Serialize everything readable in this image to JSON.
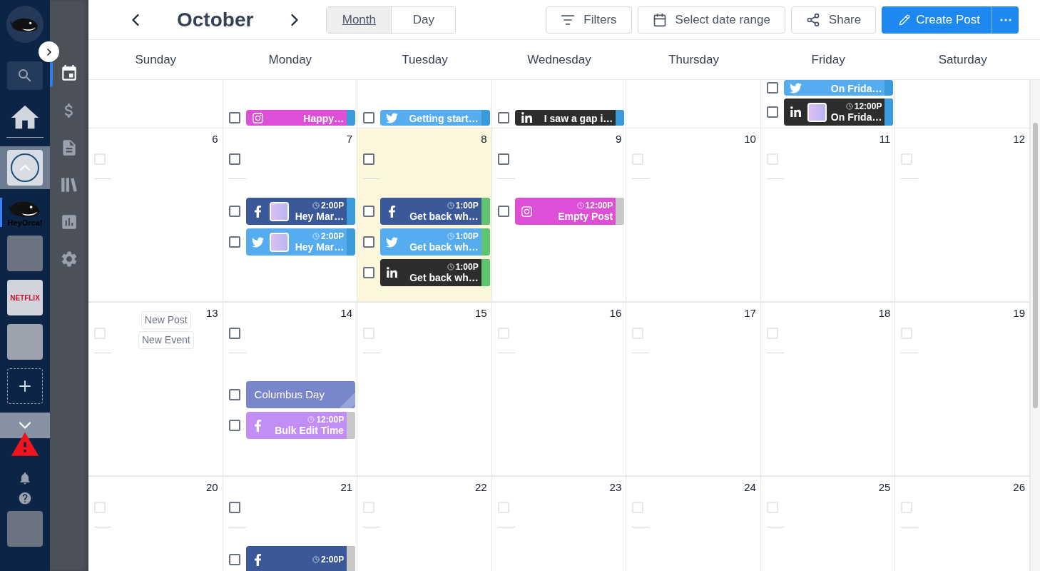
{
  "sidebar": {
    "logo": {
      "kind": "whale"
    },
    "workspaces": [
      {
        "kind": "emblem",
        "selected": false
      },
      {
        "kind": "whale",
        "label": "HeyOrca!",
        "selected": true
      },
      {
        "kind": "photo",
        "selected": false
      },
      {
        "kind": "wordmark",
        "label": "NETFLIX",
        "selected": false
      },
      {
        "kind": "texture",
        "selected": false
      },
      {
        "kind": "add",
        "selected": false
      }
    ]
  },
  "rail": [
    {
      "kind": "calendar",
      "selected": true
    },
    {
      "kind": "dollar",
      "selected": false
    },
    {
      "kind": "document",
      "selected": false
    },
    {
      "kind": "library",
      "selected": false
    },
    {
      "kind": "chart",
      "selected": false
    },
    {
      "kind": "settings",
      "selected": false
    }
  ],
  "header": {
    "month": "October",
    "view_tabs": [
      {
        "label": "Month",
        "selected": true
      },
      {
        "label": "Day",
        "selected": false
      }
    ],
    "buttons": [
      {
        "kind": "filter",
        "label": "Filters"
      },
      {
        "kind": "calendar",
        "label": "Select date range"
      },
      {
        "kind": "share",
        "label": "Share"
      },
      {
        "kind": "create",
        "label": "Create Post"
      },
      {
        "kind": "more"
      }
    ]
  },
  "weekdays": [
    "Sunday",
    "Monday",
    "Tuesday",
    "Wednesday",
    "Thursday",
    "Friday",
    "Saturday"
  ],
  "weeks": [
    {
      "cut_off": true,
      "days": [
        {
          "today": false
        },
        {
          "today": false,
          "posts": [
            {
              "kind": "instagram",
              "title": "Happy…",
              "color": "#dd4fd6",
              "status": {
                "color": "#3b9ad9"
              },
              "checked": false
            }
          ]
        },
        {
          "today": false,
          "posts": [
            {
              "kind": "twitter",
              "title": "Getting start…",
              "color": "#55acee",
              "status": {
                "color": "#3b9ad9"
              },
              "checked": false
            }
          ]
        },
        {
          "today": false,
          "posts": [
            {
              "kind": "linkedin",
              "title": "I saw a gap i…",
              "color": "#2d2d2d",
              "status": {
                "color": "#3b9ad9"
              },
              "checked": false
            }
          ]
        },
        {
          "today": false
        },
        {
          "today": false,
          "posts": [
            {
              "kind": "twitter",
              "title": "On Frida…",
              "color": "#55acee",
              "status": {
                "color": "#3b9ad9"
              },
              "checked": false
            },
            {
              "kind": "linkedin",
              "thumbnail": true,
              "time": "12:00P",
              "title": "On Frida…",
              "color": "#2d2d2d",
              "status": {
                "color": "#3b9ad9"
              },
              "checked": false
            }
          ]
        },
        {
          "today": false
        }
      ]
    },
    {
      "cut_off": false,
      "days": [
        {
          "number": "6",
          "today": false,
          "checked": false
        },
        {
          "number": "7",
          "today": false,
          "checked": false,
          "posts": [
            {
              "kind": "facebook",
              "thumbnail": true,
              "time": "2:00P",
              "title": "Hey Mar…",
              "color": "#3b5998",
              "status": {
                "color": "#3b9ad9"
              },
              "checked": false
            },
            {
              "kind": "twitter",
              "thumbnail": true,
              "time": "2:00P",
              "title": "Hey Mar…",
              "color": "#55acee",
              "status": {
                "color": "#3b9ad9"
              },
              "checked": false
            }
          ]
        },
        {
          "number": "8",
          "today": true,
          "checked": false,
          "posts": [
            {
              "kind": "facebook",
              "time": "1:00P",
              "title": "Get back wh…",
              "color": "#3b5998",
              "status": {
                "color": "#5cc56d"
              },
              "checked": false
            },
            {
              "kind": "twitter",
              "time": "1:00P",
              "title": "Get back wh…",
              "color": "#55acee",
              "status": {
                "color": "#5cc56d"
              },
              "checked": false
            },
            {
              "kind": "linkedin",
              "time": "1:00P",
              "title": "Get back wh…",
              "color": "#2d2d2d",
              "status": {
                "color": "#5cc56d"
              },
              "checked": false
            }
          ]
        },
        {
          "number": "9",
          "today": false,
          "checked": false,
          "posts": [
            {
              "kind": "instagram",
              "time": "12:00P",
              "title": "Empty Post",
              "color": "#dd4fd6",
              "status": {
                "color": "#c8c8c8"
              },
              "checked": false
            }
          ]
        },
        {
          "number": "10",
          "today": false,
          "checked": false
        },
        {
          "number": "11",
          "today": false,
          "checked": false
        },
        {
          "number": "12",
          "today": false,
          "checked": false
        }
      ]
    },
    {
      "cut_off": false,
      "days": [
        {
          "number": "13",
          "today": false,
          "checked": false,
          "actions": [
            "New Post",
            "New Event"
          ]
        },
        {
          "number": "14",
          "today": false,
          "checked": false,
          "posts": [
            {
              "kind": "event",
              "title": "Columbus Day",
              "color": "#7986cb",
              "checked": false
            },
            {
              "kind": "facebook",
              "time": "12:00P",
              "title": "Bulk Edit Time",
              "color": "#c28ef5",
              "status": {
                "color": "#c8c8c8"
              },
              "checked": false
            }
          ]
        },
        {
          "number": "15",
          "today": false,
          "checked": false
        },
        {
          "number": "16",
          "today": false,
          "checked": false
        },
        {
          "number": "17",
          "today": false,
          "checked": false
        },
        {
          "number": "18",
          "today": false,
          "checked": false
        },
        {
          "number": "19",
          "today": false,
          "checked": false
        }
      ]
    },
    {
      "cut_off": false,
      "days": [
        {
          "number": "20",
          "today": false,
          "checked": false
        },
        {
          "number": "21",
          "today": false,
          "checked": false,
          "posts": [
            {
              "kind": "facebook",
              "time": "2:00P",
              "color": "#3b5998",
              "status": {
                "color": "#c8c8c8"
              },
              "checked": false
            }
          ]
        },
        {
          "number": "22",
          "today": false,
          "checked": false
        },
        {
          "number": "23",
          "today": false,
          "checked": false
        },
        {
          "number": "24",
          "today": false,
          "checked": false
        },
        {
          "number": "25",
          "today": false,
          "checked": false
        },
        {
          "number": "26",
          "today": false,
          "checked": false
        }
      ]
    }
  ]
}
